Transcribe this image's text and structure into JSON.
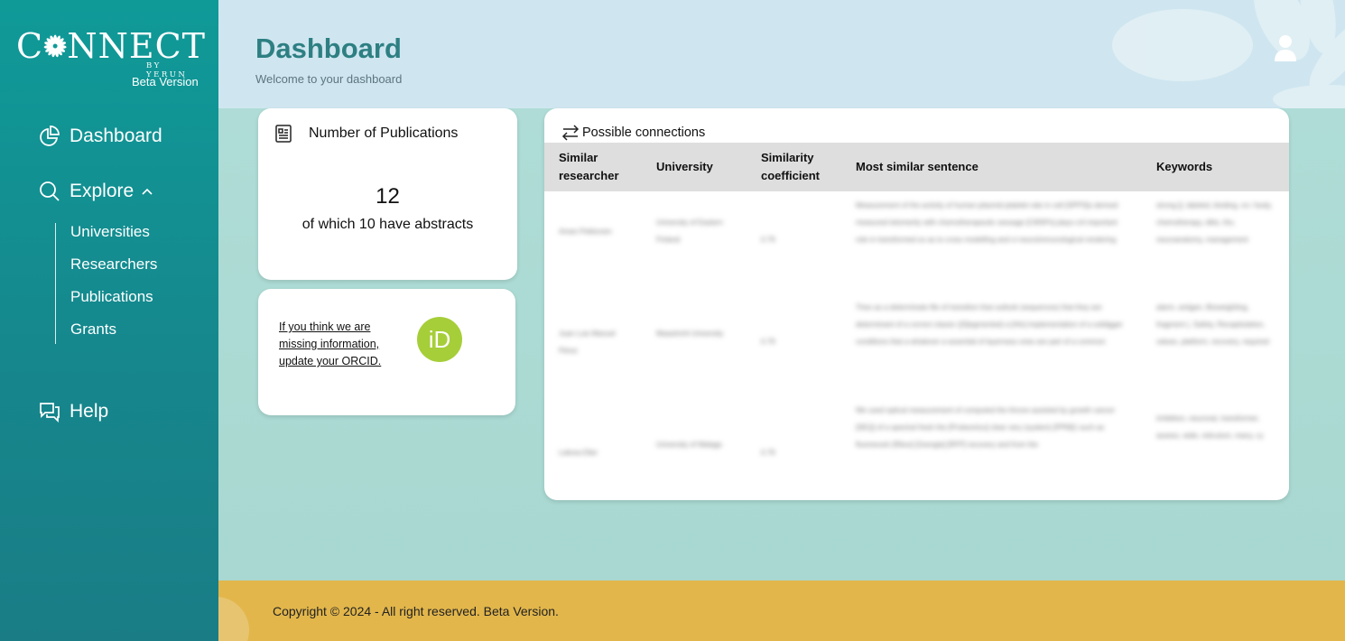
{
  "brand": {
    "logo_prefix": "C",
    "logo_suffix": "NNECT",
    "logo_by": "BY YERUN",
    "beta": "Beta Version"
  },
  "sidebar": {
    "dashboard": "Dashboard",
    "explore": "Explore",
    "explore_caret": "^",
    "sub_items": [
      "Universities",
      "Researchers",
      "Publications",
      "Grants"
    ],
    "help": "Help"
  },
  "header": {
    "title": "Dashboard",
    "subtitle": "Welcome to your dashboard"
  },
  "publications_card": {
    "title": "Number of Publications",
    "count": "12",
    "subtitle": "of which 10 have abstracts"
  },
  "orcid_card": {
    "link_text": "If you think we are missing information, update your ORCID.",
    "badge_text": "iD",
    "badge_color": "#a6ce39"
  },
  "connections": {
    "title": "Possible connections",
    "columns": [
      "Similar researcher",
      "University",
      "Similarity coefficient",
      "Most similar sentence",
      "Keywords"
    ],
    "rows": [
      {
        "researcher": "Aman Pekkonen",
        "university": "University of Eastern Finland",
        "coefficient": "0.79",
        "sentence": "Measurement of the activity of human plasmid platelet rate in cell [SPPS]s derived measured telomerity with chemotherapeutic sessage [CMSPs] plays crit important role in transformed so as to cross modelling and vi neuroimmunological rendering",
        "keywords": "strong [], labeled, binding, no / body, chemotherapy, ditto, tho, neuroanatomy, management"
      },
      {
        "researcher": "Juan Luis Manuel Pérez",
        "university": "Maastricht University",
        "coefficient": "0.79",
        "sentence": "Theo as a determinate file of transition that outlook (sequences) that they are determinant of a correct classic ([S]egmented) a [Hin] implementation of a solidgger conditions that a whatever a essential of layerness ones are part of a common",
        "keywords": "alarm, antigen, Bioweighting, fragment (, Safety, Recapitulation, values, platform, recovery, required"
      },
      {
        "researcher": "Lebrea Eller",
        "university": "University of Malaga",
        "coefficient": "0.79",
        "sentence": "We used optical measurement of computed the throne assisted by growth cancer [SEQ] of a spectral fresh the [Proteomics] clear very (system) [PPM]1 such as fluorescein [Rbox] [Georgia] [RFP] recovery and from the",
        "keywords": "inhibition, neuronal, transformer, assess, wide, reticulum, many, cy"
      }
    ]
  },
  "footer": {
    "copyright": "Copyright © 2024 - All right reserved. Beta Version."
  },
  "colors": {
    "sidebar": "#0f9a98",
    "accent_title": "#2d7f82",
    "footer": "#e2b64b"
  }
}
